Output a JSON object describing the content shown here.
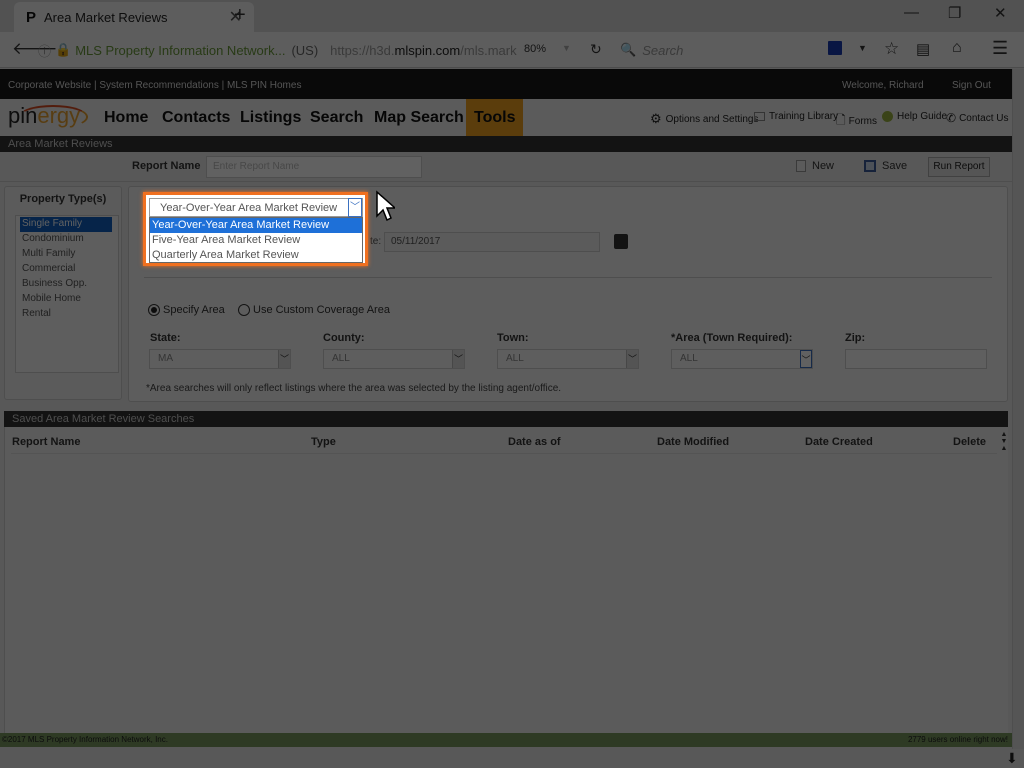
{
  "browser": {
    "tab_title": "Area Market Reviews",
    "tab_favicon": "P",
    "new_tab": "+",
    "url_site": "MLS Property Information Network...",
    "url_region": "(US)",
    "url_prefix": "https://h3d.",
    "url_domain": "mlspin.com",
    "url_path": "/mls.mark",
    "zoom": "80%",
    "search_placeholder": "Search",
    "win_minimize": "—",
    "win_restore": "❐",
    "win_close": "✕"
  },
  "topbar": {
    "links": "Corporate Website | System Recommendations | MLS PIN Homes",
    "welcome": "Welcome, Richard",
    "signout": "Sign Out"
  },
  "nav": {
    "logo_pin": "pin",
    "logo_ergy": "ergy",
    "items": [
      "Home",
      "Contacts",
      "Listings",
      "Search",
      "Map Search",
      "Tools"
    ],
    "active": "Tools",
    "utils": [
      "Options and Settings",
      "Training Library",
      "Forms",
      "Help Guide",
      "Contact Us"
    ]
  },
  "page": {
    "title": "Area Market Reviews",
    "report_name_label": "Report Name",
    "report_name_placeholder": "Enter Report Name",
    "new_label": "New",
    "save_label": "Save",
    "run_label": "Run Report"
  },
  "property_types": {
    "header": "Property Type(s)",
    "items": [
      "Single Family",
      "Condominium",
      "Multi Family",
      "Commercial",
      "Business Opp.",
      "Mobile Home",
      "Rental"
    ],
    "selected": "Single Family"
  },
  "report_type": {
    "selected": "Year-Over-Year Area Market Review",
    "options": [
      "Year-Over-Year Area Market Review",
      "Five-Year Area Market Review",
      "Quarterly Area Market Review"
    ]
  },
  "date": {
    "label_partial": "te:",
    "value": "05/11/2017"
  },
  "area": {
    "radio_specify": "Specify Area",
    "radio_custom": "Use Custom Coverage Area",
    "selected_radio": "Specify Area",
    "fields": [
      {
        "label": "State:",
        "value": "MA"
      },
      {
        "label": "County:",
        "value": "ALL"
      },
      {
        "label": "Town:",
        "value": "ALL"
      },
      {
        "label": "*Area (Town Required):",
        "value": "ALL"
      },
      {
        "label": "Zip:",
        "value": ""
      }
    ],
    "note": "*Area searches will only reflect listings where the area was selected by the listing agent/office."
  },
  "saved": {
    "header": "Saved Area Market Review Searches",
    "columns": [
      "Report Name",
      "Type",
      "Date as of",
      "Date Modified",
      "Date Created",
      "Delete"
    ],
    "rows": []
  },
  "footer": {
    "copyright": "©2017 MLS Property Information Network, Inc.",
    "online": "2779 users online right now!"
  }
}
